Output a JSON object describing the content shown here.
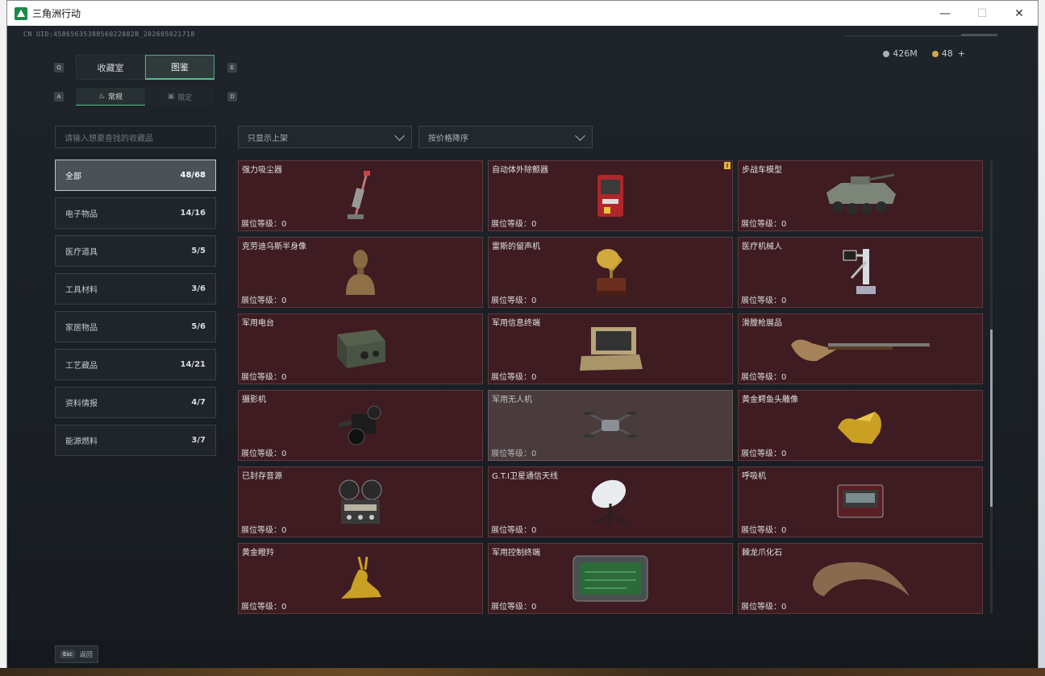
{
  "window": {
    "title": "三角洲行动",
    "controls": [
      "—",
      "☐",
      "✕"
    ]
  },
  "header": {
    "uid": "CN UID:4586563538856022882B_202605021718"
  },
  "currency": {
    "silver": "426M",
    "gold": "48",
    "plus": "+"
  },
  "keys": {
    "left_main": "Q",
    "right_main": "E",
    "left_sub": "A",
    "right_sub": "D"
  },
  "tabs": [
    {
      "label": "收藏室",
      "active": false
    },
    {
      "label": "图鉴",
      "active": true
    }
  ],
  "subtabs": [
    {
      "label": "常规",
      "active": true
    },
    {
      "label": "限定",
      "active": false
    }
  ],
  "search": {
    "placeholder": "请输入想要查找的收藏品"
  },
  "filters": {
    "shelf": "只显示上架",
    "sort": "按价格降序"
  },
  "categories": [
    {
      "label": "全部",
      "count": "48/68",
      "active": true
    },
    {
      "label": "电子物品",
      "count": "14/16"
    },
    {
      "label": "医疗道具",
      "count": "5/5"
    },
    {
      "label": "工具材料",
      "count": "3/6"
    },
    {
      "label": "家居物品",
      "count": "5/6"
    },
    {
      "label": "工艺藏品",
      "count": "14/21"
    },
    {
      "label": "资料情报",
      "count": "4/7"
    },
    {
      "label": "能源燃料",
      "count": "3/7"
    }
  ],
  "level_label": "展位等级：0",
  "items": [
    {
      "name": "强力吸尘器",
      "icon": "vacuum-icon"
    },
    {
      "name": "自动体外除颤器",
      "icon": "defibrillator-icon",
      "warn": "!"
    },
    {
      "name": "步战车模型",
      "icon": "ifv-model-icon"
    },
    {
      "name": "克劳迪乌斯半身像",
      "icon": "bust-icon"
    },
    {
      "name": "雷斯的留声机",
      "icon": "gramophone-icon"
    },
    {
      "name": "医疗机械人",
      "icon": "medical-robot-icon"
    },
    {
      "name": "军用电台",
      "icon": "radio-icon"
    },
    {
      "name": "军用信息终端",
      "icon": "terminal-icon"
    },
    {
      "name": "滑膛枪展品",
      "icon": "musket-icon"
    },
    {
      "name": "摄影机",
      "icon": "camera-icon"
    },
    {
      "name": "军用无人机",
      "icon": "drone-icon",
      "highlight": true
    },
    {
      "name": "黄金鳄鱼头雕像",
      "icon": "gold-croc-icon"
    },
    {
      "name": "已封存音源",
      "icon": "reel-recorder-icon"
    },
    {
      "name": "G.T.I卫星通信天线",
      "icon": "satellite-dish-icon"
    },
    {
      "name": "呼吸机",
      "icon": "ventilator-icon"
    },
    {
      "name": "黄金瞪羚",
      "icon": "gold-gazelle-icon"
    },
    {
      "name": "军用控制终端",
      "icon": "control-terminal-icon"
    },
    {
      "name": "棘龙爪化石",
      "icon": "claw-fossil-icon"
    }
  ],
  "footer": {
    "esc_key": "Esc",
    "esc_label": "返回"
  }
}
